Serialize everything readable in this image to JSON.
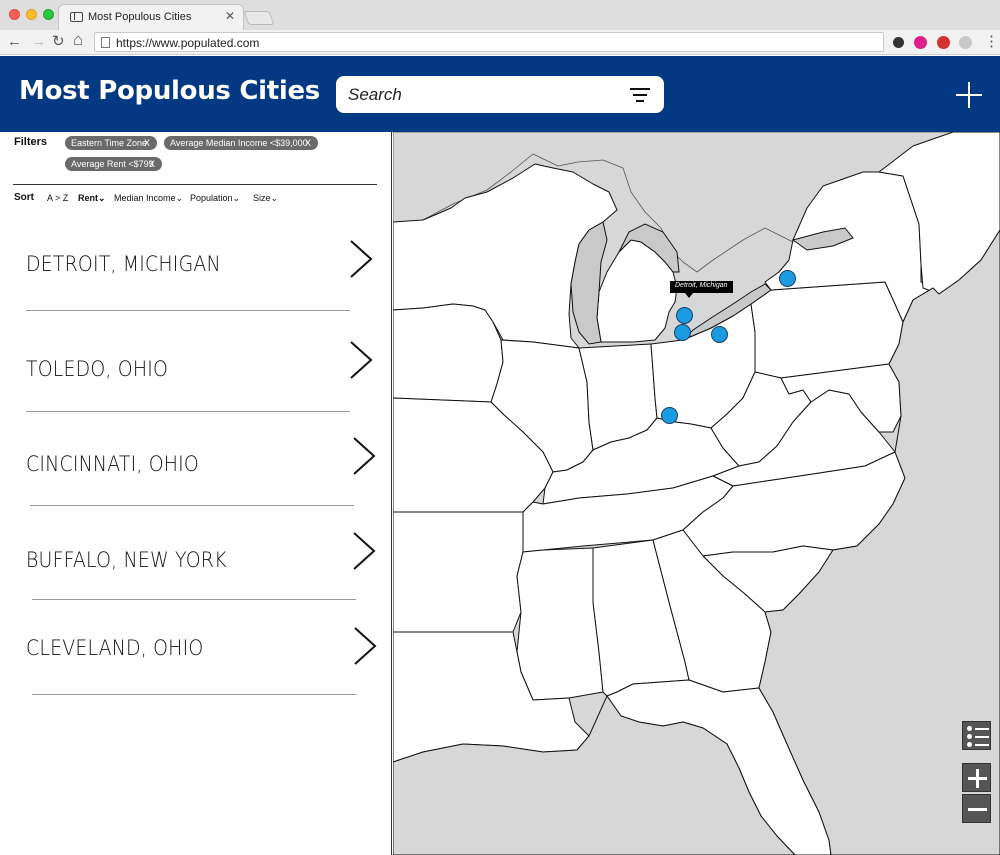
{
  "browser": {
    "tab_title": "Most Populous Cities",
    "tab_close": "✕",
    "url": "https://www.populated.com",
    "back": "←",
    "forward": "→",
    "reload": "↻",
    "home": "⌂",
    "menu": "⋮"
  },
  "header": {
    "title": "Most Populous Cities",
    "search_placeholder": "Search",
    "filter_icon": "filter-icon",
    "add_icon": "plus-icon",
    "color": "#033983"
  },
  "filters": {
    "label": "Filters",
    "chips": [
      {
        "label": "Eastern Time Zone",
        "remove": "X"
      },
      {
        "label": "Average Median Income <$39,000",
        "remove": "X"
      },
      {
        "label": "Average Rent <$799",
        "remove": "X"
      }
    ]
  },
  "sort": {
    "label": "Sort",
    "options": [
      "A > Z",
      "Rent",
      "Median Income",
      "Population",
      "Size"
    ],
    "active": "Rent"
  },
  "cities": [
    {
      "name": "DETROIT, MICHIGAN"
    },
    {
      "name": "TOLEDO, OHIO"
    },
    {
      "name": "CINCINNATI, OHIO"
    },
    {
      "name": "BUFFALO, NEW YORK"
    },
    {
      "name": "CLEVELAND, OHIO"
    }
  ],
  "map": {
    "tooltip": "Detroit, Michigan",
    "pin_color": "#1b9be0",
    "pins": [
      "Detroit",
      "Toledo",
      "Cleveland",
      "Buffalo",
      "Cincinnati"
    ]
  }
}
